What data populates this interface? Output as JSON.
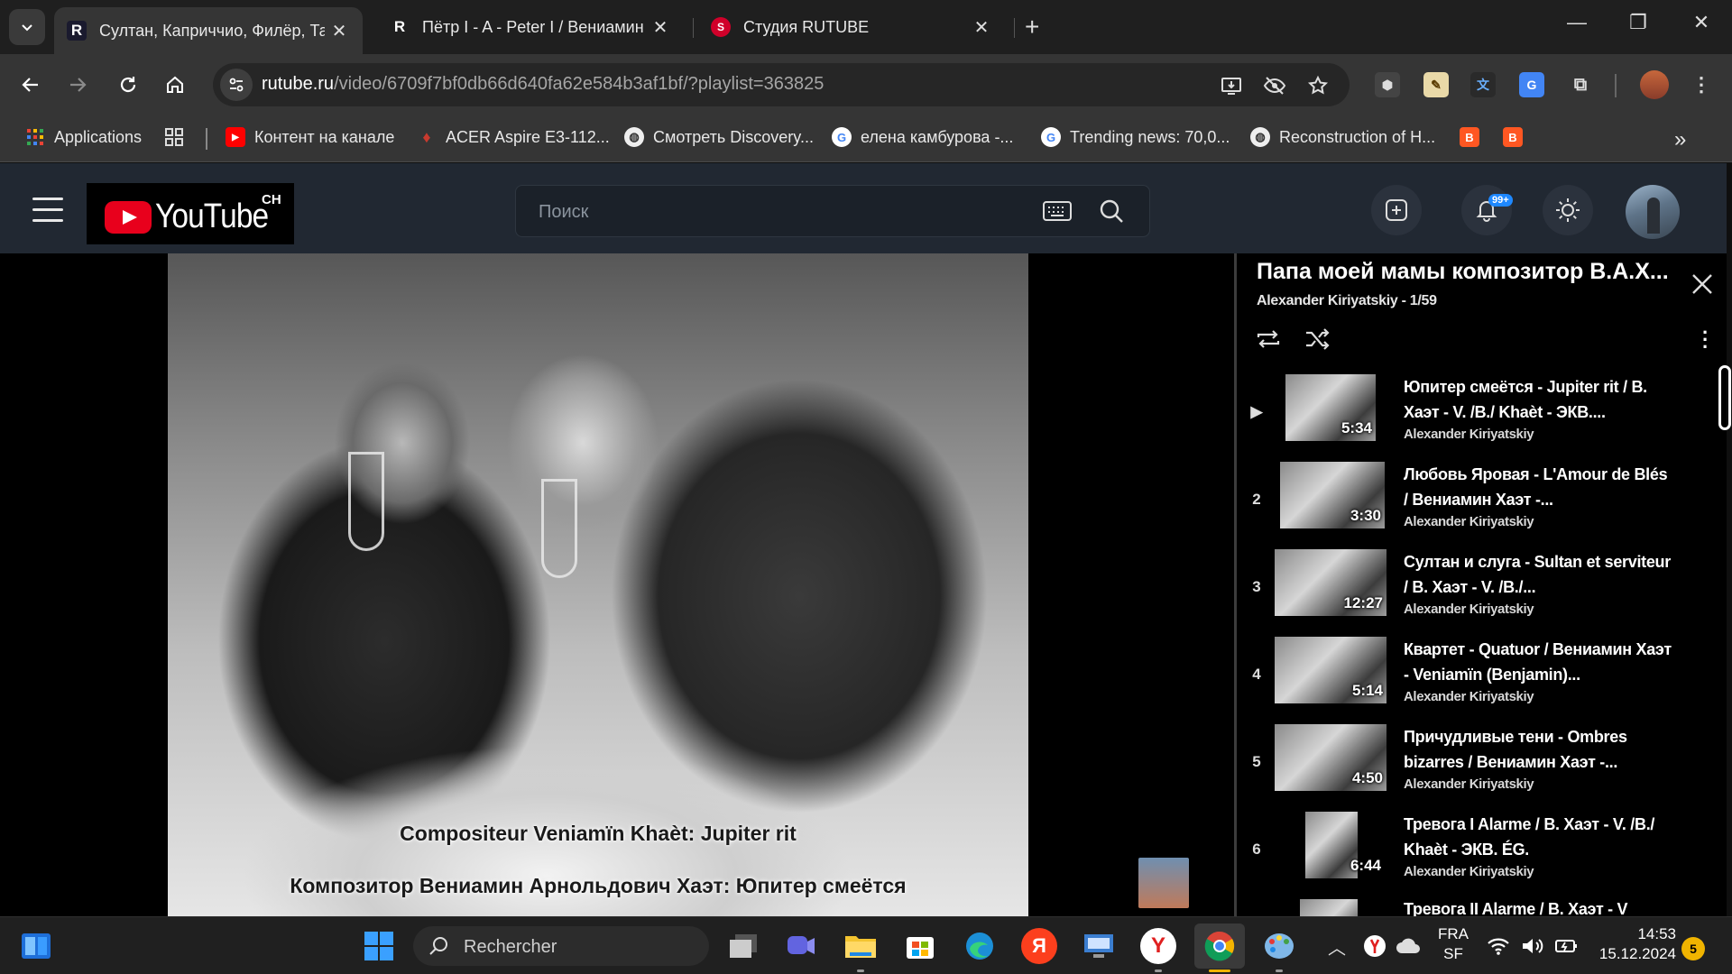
{
  "browser": {
    "tabs": [
      {
        "title": "Султан, Каприччио, Филёр, Та",
        "favicon": "rutube-icon",
        "active": true
      },
      {
        "title": "Пётр I - A - Peter I / Вениамин",
        "favicon": "rutube-icon",
        "active": false
      },
      {
        "title": "Студия RUTUBE",
        "favicon": "rutube-studio-icon",
        "active": false
      }
    ],
    "address": {
      "host": "rutube.ru",
      "path": "/video/6709f7bf0db66d640fa62e584b3af1bf/?playlist=363825"
    },
    "bookmarks": [
      {
        "label": "Applications",
        "icon": "apps-grid-icon"
      },
      {
        "label": "",
        "icon": "tab-groups-icon"
      },
      {
        "label": "Контент на канале",
        "icon": "youtube-icon"
      },
      {
        "label": "ACER Aspire E3-112...",
        "icon": "acer-icon"
      },
      {
        "label": "Смотреть Discovery...",
        "icon": "globe-icon"
      },
      {
        "label": "елена камбурова -...",
        "icon": "google-icon"
      },
      {
        "label": "Trending news: 70,0...",
        "icon": "google-icon"
      },
      {
        "label": "Reconstruction of H...",
        "icon": "globe-icon"
      }
    ],
    "bookmarks_overflow": "»"
  },
  "youtube": {
    "logo_word": "YouTube",
    "logo_region": "CH",
    "search_placeholder": "Поиск",
    "notifications_badge": "99+",
    "colors": {
      "accent_red": "#e8001c",
      "badge_blue": "#1e88ff",
      "header_bg": "#212832"
    }
  },
  "video": {
    "caption_fr": "Compositeur Veniamïn Khaèt: Jupiter rit",
    "caption_ru": "Композитор Вениамин Арнольдович Хаэт: Юпитер смеётся"
  },
  "playlist": {
    "title": "Папа моей мамы композитор В.А.Х...",
    "subtitle": "Alexander Kiriyatskiy - 1/59",
    "items": [
      {
        "index": "▶",
        "title": "Юпитер смеётся - Jupiter rit / В. Хаэт - V. /B./ Khaèt - ЭКВ....",
        "channel": "Alexander Kiriyatskiy",
        "duration": "5:34"
      },
      {
        "index": "2",
        "title": "Любовь Яровая - L'Amour de Blés / Вениамин Хаэт -...",
        "channel": "Alexander Kiriyatskiy",
        "duration": "3:30"
      },
      {
        "index": "3",
        "title": "Султан и слуга - Sultan et serviteur / В. Хаэт - V. /B./...",
        "channel": "Alexander Kiriyatskiy",
        "duration": "12:27"
      },
      {
        "index": "4",
        "title": "Квартет - Quatuor / Вениамин Хаэт - Veniamïn (Benjamin)...",
        "channel": "Alexander Kiriyatskiy",
        "duration": "5:14"
      },
      {
        "index": "5",
        "title": "Причудливые тени - Ombres bizarres / Вениамин Хаэт -...",
        "channel": "Alexander Kiriyatskiy",
        "duration": "4:50"
      },
      {
        "index": "6",
        "title": "Тревога I Alarme / В. Хаэт - V. /B./ Khaèt - ЭКВ. ÉG.",
        "channel": "Alexander Kiriyatskiy",
        "duration": "6:44"
      },
      {
        "index": "",
        "title": "Тревога II Alarme / В. Хаэт - V",
        "channel": "",
        "duration": ""
      }
    ]
  },
  "taskbar": {
    "search_placeholder": "Rechercher",
    "language": "FRA",
    "layout": "SF",
    "time": "14:53",
    "date": "15.12.2024",
    "notifications": "5"
  }
}
